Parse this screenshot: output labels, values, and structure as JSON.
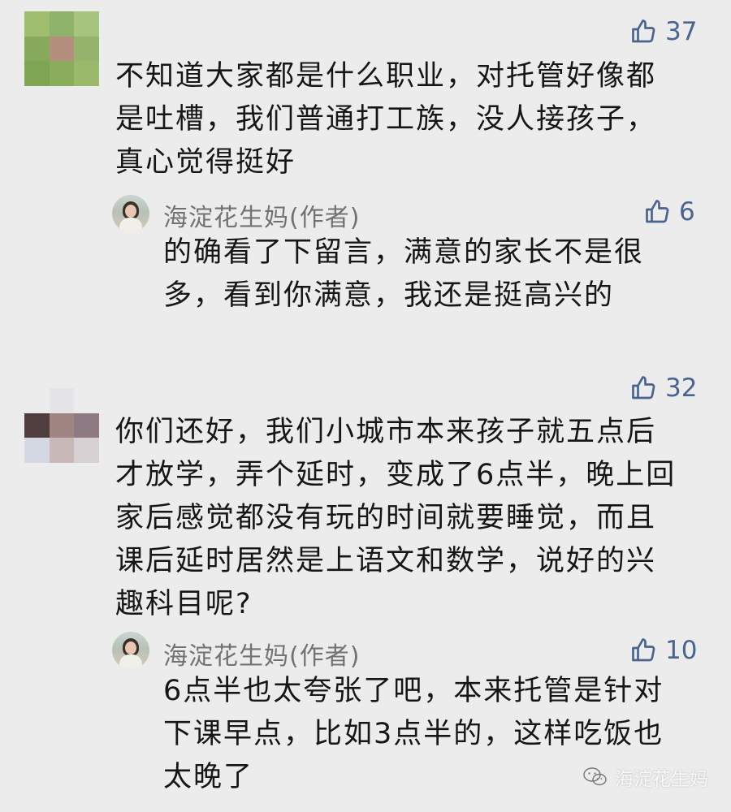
{
  "comments": [
    {
      "likes": "37",
      "text": "不知道大家都是什么职业，对托管好像都\n是吐槽，我们普通打工族，没人接孩子，\n真心觉得挺好",
      "reply": {
        "author": "海淀花生妈(作者)",
        "likes": "6",
        "text": "的确看了下留言，满意的家长不是很\n多，看到你满意，我还是挺高兴的"
      }
    },
    {
      "likes": "32",
      "text": "你们还好，我们小城市本来孩子就五点后\n才放学，弄个延时，变成了6点半，晚上回\n家后感觉都没有玩的时间就要睡觉，而且\n课后延时居然是上语文和数学，说好的兴\n趣科目呢?",
      "reply": {
        "author": "海淀花生妈(作者)",
        "likes": "10",
        "text": "6点半也太夸张了吧，本来托管是针对\n下课早点，比如3点半的，这样吃饭也\n太晚了"
      }
    }
  ],
  "watermark": "海淀花生妈",
  "colors": {
    "background": "#ececec",
    "like": "#4a6490",
    "author": "#727272"
  },
  "icons": {
    "like": "thumbs-up-icon",
    "watermark": "wechat-icon"
  }
}
